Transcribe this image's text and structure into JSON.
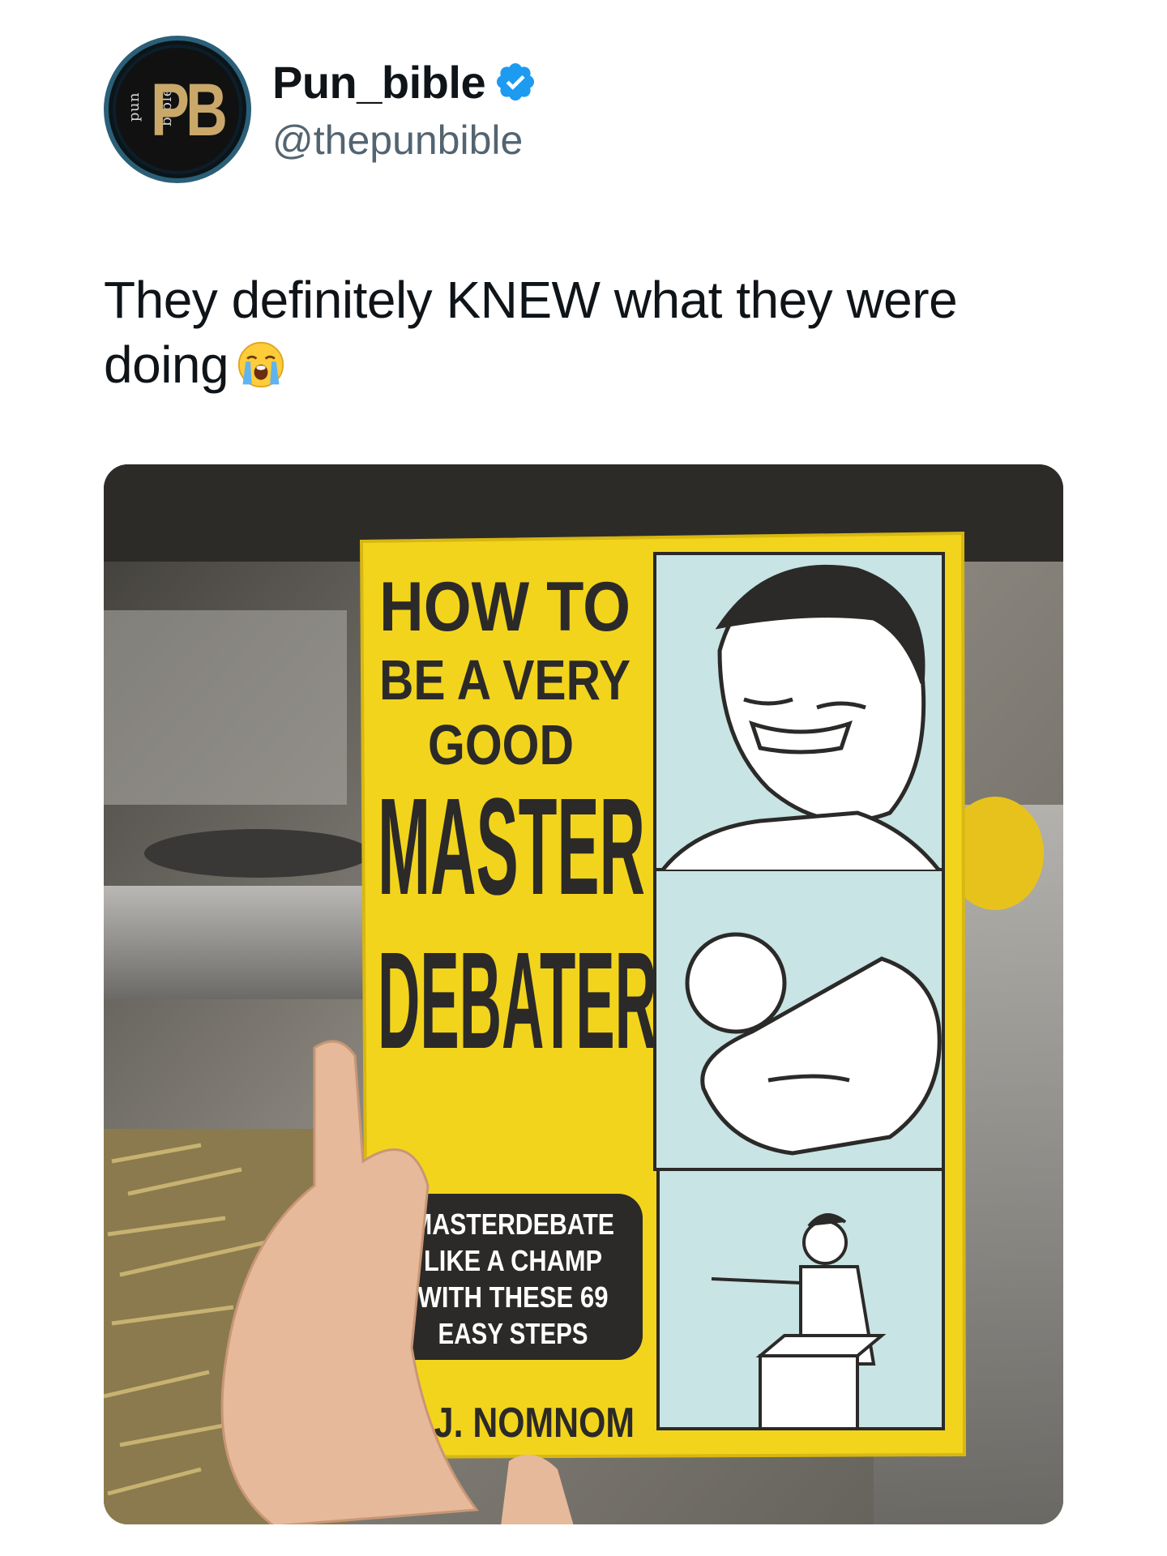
{
  "author": {
    "display_name": "Pun_bible",
    "handle": "@thepunbible",
    "verified": true,
    "avatar": {
      "monogram": "PB",
      "small_text": "pun bible",
      "accent": "#c9a86a"
    },
    "verified_color": "#1d9bf0"
  },
  "tweet": {
    "text_line1": "They definitely KNEW what they were",
    "text_line2": "doing",
    "emoji": "loudly-crying-face-icon"
  },
  "media": {
    "book_cover": {
      "title_line1": "HOW TO",
      "title_line2": "BE A VERY",
      "title_line3": "GOOD",
      "title_line4": "MASTER",
      "title_line5": "DEBATER",
      "tagline_line1": "MASTERDEBATE",
      "tagline_line2": "LIKE A CHAMP",
      "tagline_line3": "WITH THESE 69",
      "tagline_line4": "EASY STEPS",
      "author": "B.J. NOMNOM",
      "cover_color": "#f3d41c",
      "panel_color": "#c8e4e4"
    }
  }
}
